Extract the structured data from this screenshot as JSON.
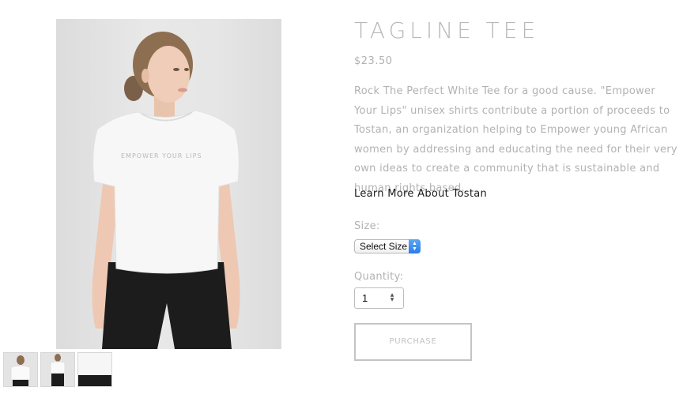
{
  "product": {
    "title": "TAGLINE TEE",
    "price": "$23.50",
    "description": "Rock The Perfect White Tee for a good cause.  \"Empower Your Lips\" unisex shirts contribute a portion of proceeds to Tostan, an organization helping to Empower young African women by addressing and educating the need for their very own ideas to create a community that is sustainable and human rights based.",
    "learn_more_link": "Learn More About Tostan",
    "shirt_print_text": "EMPOWER YOUR LIPS",
    "images": {
      "main": "model-wearing-white-tee-photo",
      "thumbnails": [
        "front-view-thumbnail",
        "full-view-thumbnail",
        "detail-view-thumbnail"
      ]
    }
  },
  "options": {
    "size_label": "Size:",
    "size_selected": "Select Size",
    "quantity_label": "Quantity:",
    "quantity_value": "1"
  },
  "actions": {
    "purchase_label": "PURCHASE"
  },
  "colors": {
    "title_gray": "#b9b9b9",
    "text_gray": "#b2b2b2",
    "link_dark": "#1a1a1a",
    "select_accent_blue": "#2a7de8",
    "button_border": "#c4c4c4"
  }
}
